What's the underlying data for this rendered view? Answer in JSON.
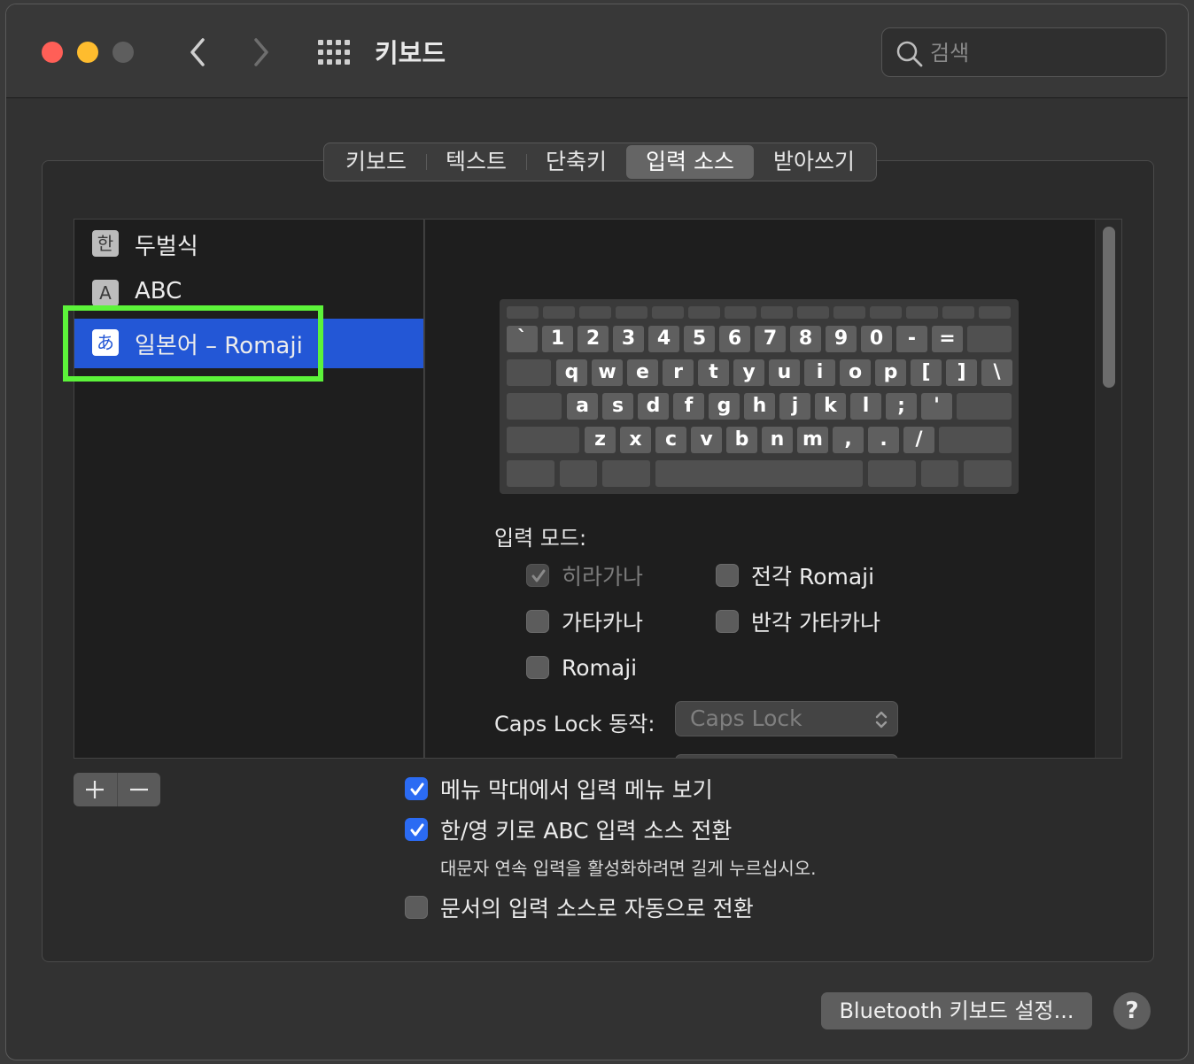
{
  "window": {
    "title": "키보드",
    "search_placeholder": "검색"
  },
  "tabs": [
    {
      "label": "키보드",
      "active": false
    },
    {
      "label": "텍스트",
      "active": false
    },
    {
      "label": "단축키",
      "active": false
    },
    {
      "label": "입력 소스",
      "active": true
    },
    {
      "label": "받아쓰기",
      "active": false
    }
  ],
  "input_sources": [
    {
      "icon_glyph": "한",
      "label": "두벌식",
      "selected": false
    },
    {
      "icon_glyph": "A",
      "label": "ABC",
      "selected": false
    },
    {
      "icon_glyph": "あ",
      "label": "일본어 – Romaji",
      "selected": true
    }
  ],
  "keyboard": {
    "row1": [
      "`",
      "1",
      "2",
      "3",
      "4",
      "5",
      "6",
      "7",
      "8",
      "9",
      "0",
      "-",
      "="
    ],
    "row2": [
      "q",
      "w",
      "e",
      "r",
      "t",
      "y",
      "u",
      "i",
      "o",
      "p",
      "[",
      "]",
      "\\"
    ],
    "row3": [
      "a",
      "s",
      "d",
      "f",
      "g",
      "h",
      "j",
      "k",
      "l",
      ";",
      "'"
    ],
    "row4": [
      "z",
      "x",
      "c",
      "v",
      "b",
      "n",
      "m",
      ",",
      ".",
      "/"
    ]
  },
  "input_mode": {
    "heading": "입력 모드:",
    "hiragana": {
      "label": "히라가나",
      "checked": true,
      "disabled": true
    },
    "katakana": {
      "label": "가타카나",
      "checked": false
    },
    "romaji": {
      "label": "Romaji",
      "checked": false
    },
    "fullwidth_romaji": {
      "label": "전각 Romaji",
      "checked": false
    },
    "halfwidth_katakana": {
      "label": "반각 가타카나",
      "checked": false
    }
  },
  "caps_lock": {
    "label": "Caps Lock 동작:",
    "value": "Caps Lock"
  },
  "options": {
    "show_menu": {
      "label": "메뉴 막대에서 입력 메뉴 보기",
      "checked": true
    },
    "switch_key": {
      "label": "한/영 키로 ABC 입력 소스 전환",
      "checked": true
    },
    "switch_hint": "대문자 연속 입력을 활성화하려면 길게 누르십시오.",
    "auto_switch": {
      "label": "문서의 입력 소스로 자동으로 전환",
      "checked": false
    }
  },
  "footer": {
    "bluetooth_button": "Bluetooth 키보드 설정...",
    "help_button": "?"
  },
  "colors": {
    "accent": "#2b6bf3",
    "selection": "#2357d6",
    "highlight_box": "#5cf33a"
  }
}
